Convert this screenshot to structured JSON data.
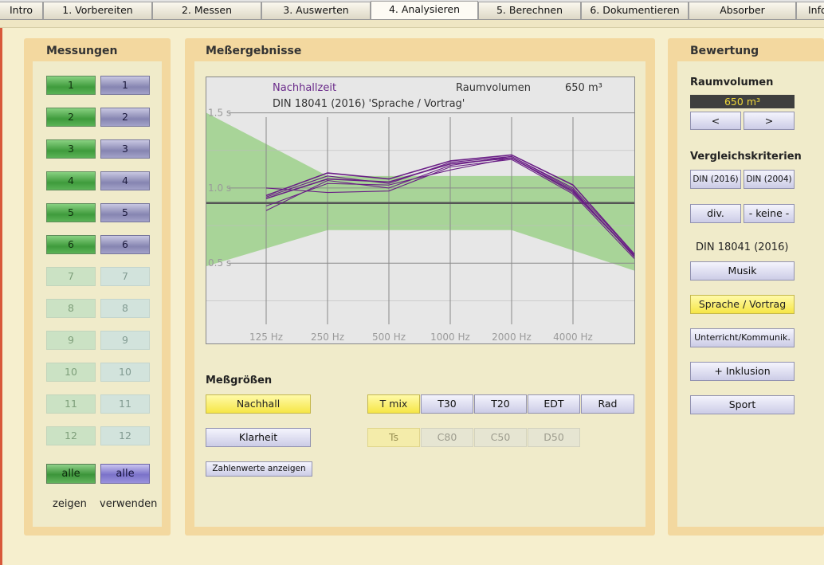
{
  "tabs": [
    "Intro",
    "1. Vorbereiten",
    "2. Messen",
    "3. Auswerten",
    "4. Analysieren",
    "5. Berechnen",
    "6. Dokumentieren",
    "Absorber",
    "Info"
  ],
  "active_tab": "4. Analysieren",
  "measurements": {
    "title": "Messungen",
    "items": [
      "1",
      "2",
      "3",
      "4",
      "5",
      "6",
      "7",
      "8",
      "9",
      "10",
      "11",
      "12"
    ],
    "active_count": 6,
    "all_show": "alle",
    "all_use": "alle",
    "show_label": "zeigen",
    "use_label": "verwenden"
  },
  "results": {
    "title": "Meßergebnisse",
    "chart_data": {
      "type": "line",
      "title": "Nachhallzeit",
      "subtitle": "DIN 18041 (2016) 'Sprache / Vortrag'",
      "volume_label": "Raumvolumen",
      "volume_value": "650 m³",
      "x_ticks": [
        "125 Hz",
        "250 Hz",
        "500 Hz",
        "1000 Hz",
        "2000 Hz",
        "4000 Hz"
      ],
      "y_ticks": [
        "1.5 s",
        "1.0 s",
        "0.5 s"
      ],
      "y_tick_values": [
        1.5,
        1.0,
        0.5
      ],
      "ylim": [
        0.22,
        1.62
      ],
      "x_positions_octaves": [
        0,
        1,
        2,
        3,
        4,
        5
      ],
      "xlim_octaves": [
        -1,
        6.3
      ],
      "target_value": 0.9,
      "tolerance_band": {
        "x": [
          -1,
          1,
          4,
          6.3
        ],
        "upper": [
          1.5,
          1.08,
          1.08,
          1.08
        ],
        "lower": [
          0.48,
          0.72,
          0.72,
          0.45
        ]
      },
      "series": [
        {
          "x": [
            0,
            1,
            2,
            3,
            4,
            5,
            6.3
          ],
          "values": [
            0.93,
            1.06,
            1.04,
            1.16,
            1.2,
            0.98,
            0.55
          ]
        },
        {
          "x": [
            0,
            1,
            2,
            3,
            4,
            5,
            6.3
          ],
          "values": [
            0.95,
            1.1,
            1.06,
            1.18,
            1.22,
            1.02,
            0.56
          ]
        },
        {
          "x": [
            0,
            1,
            2,
            3,
            4,
            5,
            6.3
          ],
          "values": [
            0.88,
            1.03,
            1.02,
            1.12,
            1.2,
            0.97,
            0.55
          ]
        },
        {
          "x": [
            0,
            1,
            2,
            3,
            4,
            5,
            6.3
          ],
          "values": [
            0.85,
            1.05,
            1.0,
            1.15,
            1.21,
            0.99,
            0.54
          ]
        },
        {
          "x": [
            0,
            1,
            2,
            3,
            4,
            5,
            6.3
          ],
          "values": [
            1.0,
            0.97,
            0.98,
            1.14,
            1.19,
            0.96,
            0.53
          ]
        },
        {
          "x": [
            0,
            1,
            2,
            3,
            4,
            5,
            6.3
          ],
          "values": [
            0.94,
            1.08,
            1.03,
            1.17,
            1.21,
            1.0,
            0.56
          ]
        }
      ],
      "colors": {
        "band": "#a8d498",
        "line": "#6a1f86",
        "target": "#555555",
        "grid": "#8a8a8a",
        "title": "#6a2a8a"
      }
    },
    "quantities_title": "Meßgrößen",
    "nachhall": "Nachhall",
    "klarheit": "Klarheit",
    "show_numbers": "Zahlenwerte anzeigen",
    "metrics_row1": [
      "T mix",
      "T30",
      "T20",
      "EDT",
      "Rad"
    ],
    "metrics_row2": [
      "Ts",
      "C80",
      "C50",
      "D50"
    ]
  },
  "evaluation": {
    "title": "Bewertung",
    "volume_title": "Raumvolumen",
    "volume_value": "650 m³",
    "prev": "<",
    "next": ">",
    "criteria_title": "Vergleichskriterien",
    "din2016": "DIN (2016)",
    "din2004": "DIN (2004)",
    "div": "div.",
    "none": "- keine -",
    "standard": "DIN 18041 (2016)",
    "options": [
      "Musik",
      "Sprache / Vortrag",
      "Unterricht/Kommunik.",
      "+ Inklusion",
      "Sport"
    ],
    "selected": "Sprache / Vortrag"
  }
}
